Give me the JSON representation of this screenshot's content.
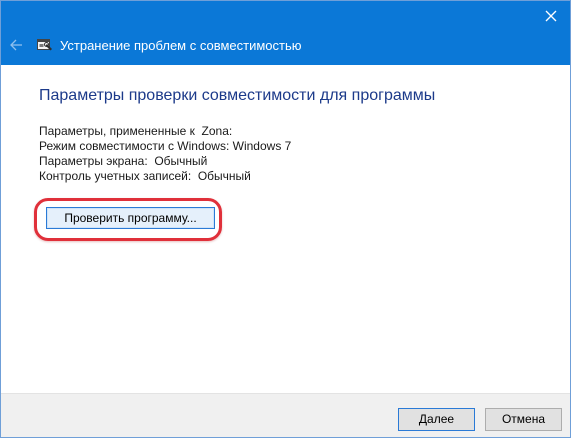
{
  "window": {
    "title": "Устранение проблем с совместимостью",
    "accent_color": "#0b78d7",
    "icons": [
      "close-icon",
      "back-arrow-icon",
      "troubleshooter-icon"
    ]
  },
  "content": {
    "heading": "Параметры проверки совместимости для программы",
    "settings": {
      "applied_to": "Параметры, примененные к  Zona:",
      "compat_mode": "Режим совместимости с Windows: Windows 7",
      "screen": "Параметры экрана:  Обычный",
      "uac": "Контроль учетных записей:  Обычный"
    },
    "test_button_label": "Проверить программу..."
  },
  "footer": {
    "next_label": "Далее",
    "cancel_label": "Отмена"
  },
  "annotation_color": "#e0303a"
}
